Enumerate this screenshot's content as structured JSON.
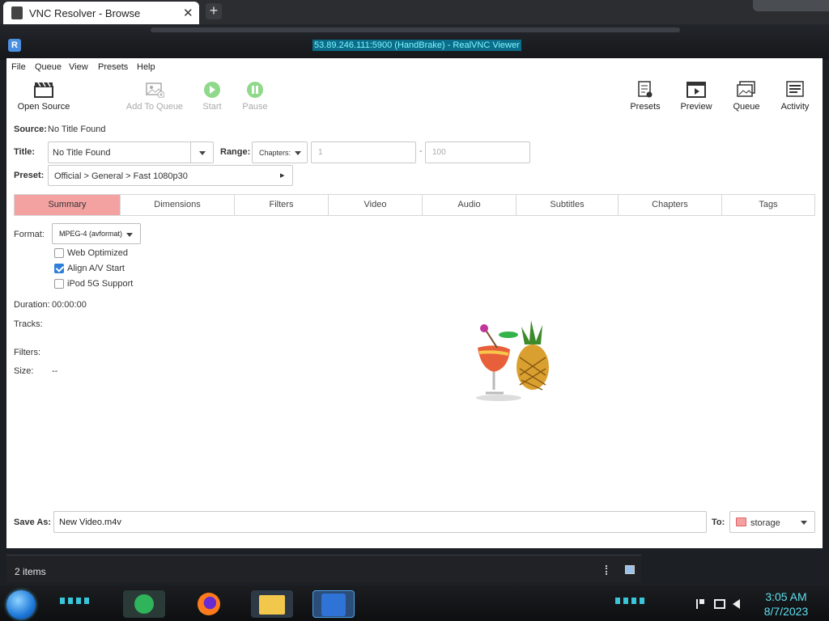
{
  "browser": {
    "tab_title": "VNC Resolver - Browse",
    "close_glyph": "✕",
    "new_tab_glyph": "+"
  },
  "vnc": {
    "window_title": "53.89.246.111:5900 (HandBrake) - RealVNC Viewer",
    "logo_letter": "R"
  },
  "menu": [
    "File",
    "Queue",
    "View",
    "Presets",
    "Help"
  ],
  "toolbar": {
    "left": [
      {
        "label": "Open Source",
        "icon": "clapperboard-icon",
        "enabled": true
      },
      {
        "label": "Add To Queue",
        "icon": "add-to-queue-icon",
        "enabled": false
      },
      {
        "label": "Start",
        "icon": "play-icon",
        "enabled": false
      },
      {
        "label": "Pause",
        "icon": "pause-icon",
        "enabled": false
      }
    ],
    "right": [
      {
        "label": "Presets",
        "icon": "presets-icon"
      },
      {
        "label": "Preview",
        "icon": "preview-icon"
      },
      {
        "label": "Queue",
        "icon": "queue-icon"
      },
      {
        "label": "Activity",
        "icon": "activity-icon"
      }
    ]
  },
  "source": {
    "label": "Source:",
    "value": "No Title Found"
  },
  "title": {
    "label": "Title:",
    "value": "No Title Found"
  },
  "range": {
    "label": "Range:",
    "mode": "Chapters:",
    "start": "1",
    "dash": "-",
    "end": "100"
  },
  "preset": {
    "label": "Preset:",
    "value": "Official > General > Fast 1080p30",
    "arrow": "▸"
  },
  "tabs": [
    "Summary",
    "Dimensions",
    "Filters",
    "Video",
    "Audio",
    "Subtitles",
    "Chapters",
    "Tags"
  ],
  "active_tab": "Summary",
  "summary": {
    "format_label": "Format:",
    "format_value": "MPEG-4 (avformat)",
    "checkboxes": [
      {
        "label": "Web Optimized",
        "checked": false
      },
      {
        "label": "Align A/V Start",
        "checked": true
      },
      {
        "label": "iPod 5G Support",
        "checked": false
      }
    ],
    "duration_label": "Duration:",
    "duration_value": "00:00:00",
    "tracks_label": "Tracks:",
    "filters_label": "Filters:",
    "size_label": "Size:",
    "size_value": "--"
  },
  "save": {
    "label": "Save As:",
    "value": "New Video.m4v",
    "to_label": "To:",
    "folder": "storage"
  },
  "status": {
    "items": "2 items"
  },
  "taskbar": {
    "time": "3:05 AM",
    "date": "8/7/2023"
  },
  "colors": {
    "active_tab": "#f4a1a1",
    "accent": "#2f7fd8",
    "clock": "#5ee0f0"
  }
}
